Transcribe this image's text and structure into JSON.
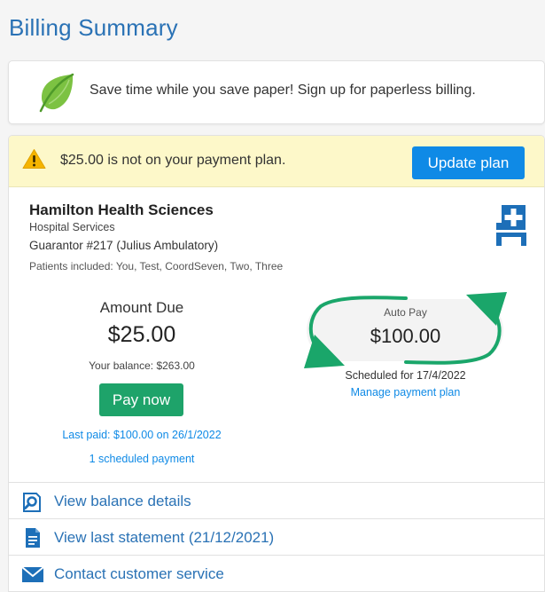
{
  "page": {
    "title": "Billing Summary"
  },
  "paperless": {
    "message": "Save time while you save paper! Sign up for paperless billing."
  },
  "alert": {
    "message": "$25.00 is not on your payment plan.",
    "button_label": "Update plan"
  },
  "provider": {
    "name": "Hamilton Health Sciences",
    "type": "Hospital Services",
    "guarantor": "Guarantor #217 (Julius Ambulatory)",
    "patients": "Patients included: You, Test, CoordSeven, Two, Three"
  },
  "amount_due": {
    "label": "Amount Due",
    "value": "$25.00",
    "balance": "Your balance: $263.00",
    "pay_button": "Pay now",
    "last_paid": "Last paid: $100.00 on 26/1/2022",
    "scheduled_payments": "1 scheduled payment"
  },
  "autopay": {
    "label": "Auto Pay",
    "amount": "$100.00",
    "scheduled_for": "Scheduled for 17/4/2022",
    "manage_link": "Manage payment plan"
  },
  "actions": [
    {
      "label": "View balance details",
      "icon": "magnifier-document-icon"
    },
    {
      "label": "View last statement (21/12/2021)",
      "icon": "document-icon"
    },
    {
      "label": "Contact customer service",
      "icon": "envelope-icon"
    }
  ],
  "colors": {
    "link_blue": "#2a72b5",
    "accent_blue": "#0f8ae6",
    "pay_green": "#1ea36a",
    "autopay_green": "#1aa66a",
    "alert_bg": "#fdf8c9",
    "warning_yellow": "#f5b400"
  }
}
